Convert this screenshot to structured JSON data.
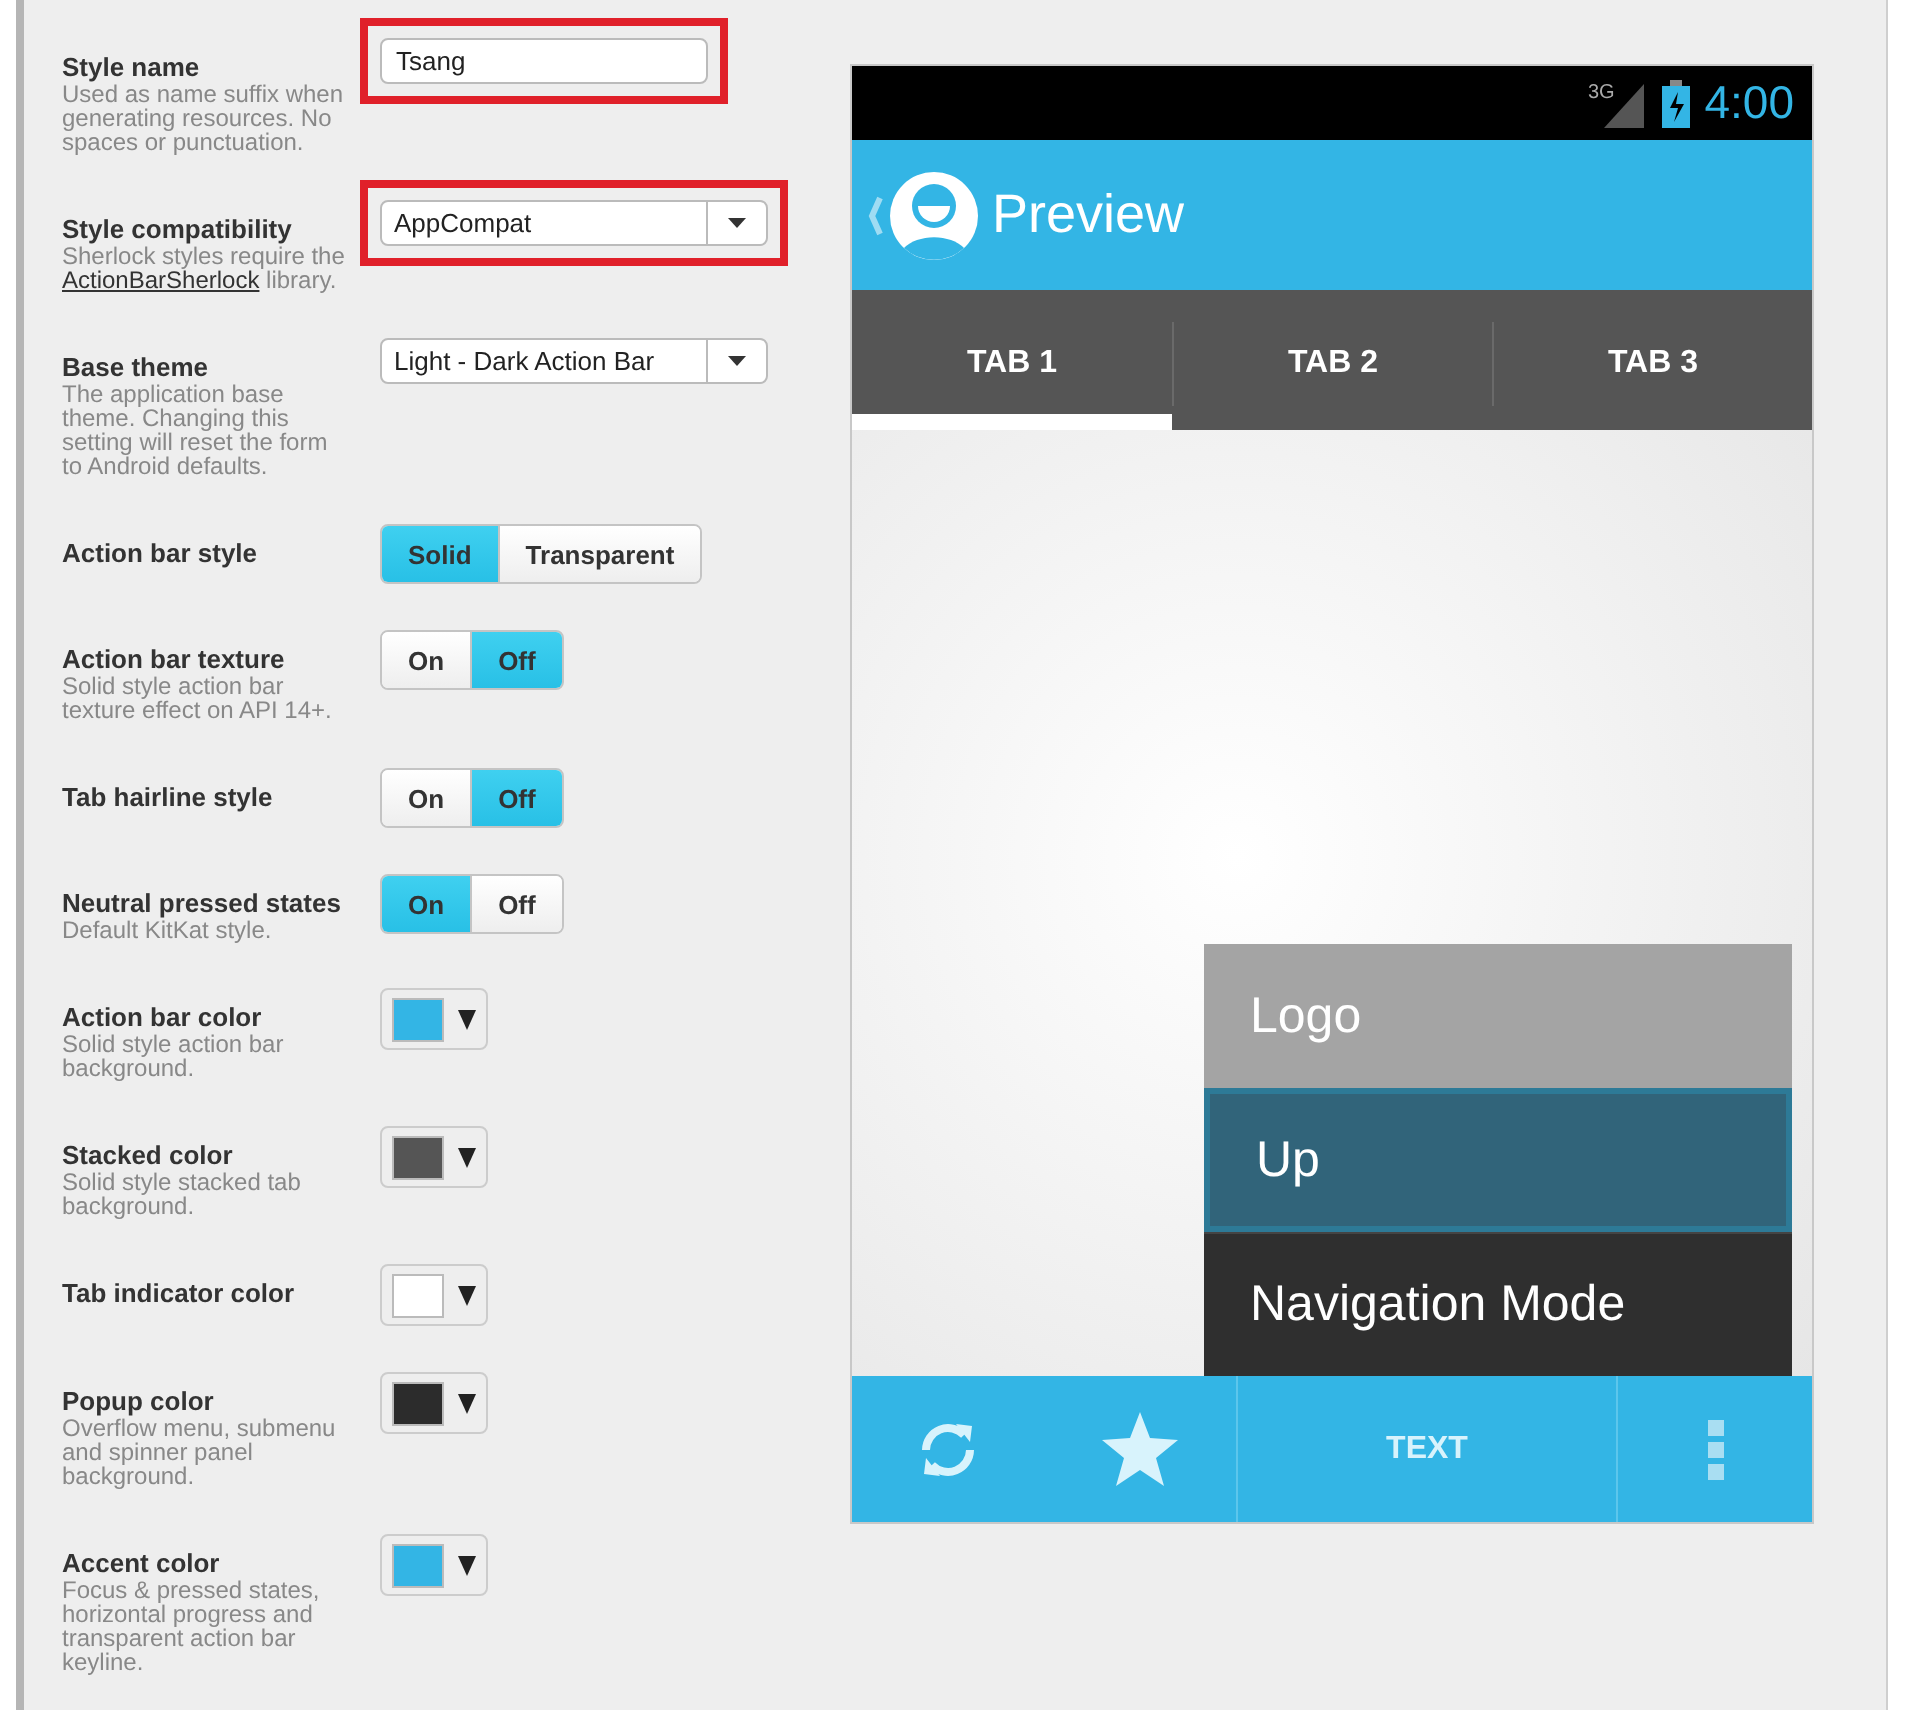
{
  "settings": [
    {
      "kind": "text",
      "label": "Style name",
      "description": "Used as name suffix when generating resources. No spaces or punctuation.",
      "value": "Tsang",
      "highlighted": true
    },
    {
      "kind": "select",
      "label": "Style compatibility",
      "description": "Sherlock styles require the ",
      "link": "ActionBarSherlock",
      "description_after": " library.",
      "value": "AppCompat",
      "highlighted": true
    },
    {
      "kind": "select",
      "label": "Base theme",
      "description": "The application base theme. Changing this setting will reset the form to Android defaults.",
      "value": "Light - Dark Action Bar",
      "highlighted": false
    },
    {
      "kind": "segmented",
      "label": "Action bar style",
      "options": [
        {
          "label": "Solid",
          "selected": true
        },
        {
          "label": "Transparent",
          "selected": false
        }
      ],
      "highlighted": false
    },
    {
      "kind": "segmented",
      "label": "Action bar texture",
      "description": "Solid style action bar texture effect on API 14+.",
      "options": [
        {
          "label": "On",
          "selected": false
        },
        {
          "label": "Off",
          "selected": true
        }
      ],
      "highlighted": false
    },
    {
      "kind": "segmented",
      "label": "Tab hairline style",
      "options": [
        {
          "label": "On",
          "selected": false
        },
        {
          "label": "Off",
          "selected": true
        }
      ],
      "highlighted": false
    },
    {
      "kind": "segmented",
      "label": "Neutral pressed states",
      "description": "Default KitKat style.",
      "options": [
        {
          "label": "On",
          "selected": true
        },
        {
          "label": "Off",
          "selected": false
        }
      ],
      "highlighted": false
    },
    {
      "kind": "color",
      "label": "Action bar color",
      "description": "Solid style action bar background.",
      "color": "#33b5e5",
      "highlighted": false
    },
    {
      "kind": "color",
      "label": "Stacked color",
      "description": "Solid style stacked tab background.",
      "color": "#555555",
      "highlighted": false
    },
    {
      "kind": "color",
      "label": "Tab indicator color",
      "color": "#ffffff",
      "highlighted": false
    },
    {
      "kind": "color",
      "label": "Popup color",
      "description": "Overflow menu, submenu and spinner panel background.",
      "color": "#2c2c2c",
      "highlighted": false
    },
    {
      "kind": "color",
      "label": "Accent color",
      "description": "Focus & pressed states, horizontal progress and transparent action bar keyline.",
      "color": "#33b5e5",
      "highlighted": false
    }
  ],
  "preview": {
    "status_bar": {
      "network": "3G",
      "time": "4:00"
    },
    "action_bar": {
      "title": "Preview"
    },
    "tabs": [
      {
        "label": "TAB 1",
        "selected": true
      },
      {
        "label": "TAB 2",
        "selected": false
      },
      {
        "label": "TAB 3",
        "selected": false
      }
    ],
    "popup_menu": [
      {
        "label": "Logo",
        "selected": false
      },
      {
        "label": "Up",
        "selected": true
      },
      {
        "label": "Navigation Mode",
        "selected": false
      }
    ],
    "bottom_bar": [
      {
        "kind": "refresh"
      },
      {
        "kind": "star"
      },
      {
        "kind": "text",
        "label": "TEXT"
      },
      {
        "kind": "overflow"
      }
    ]
  }
}
